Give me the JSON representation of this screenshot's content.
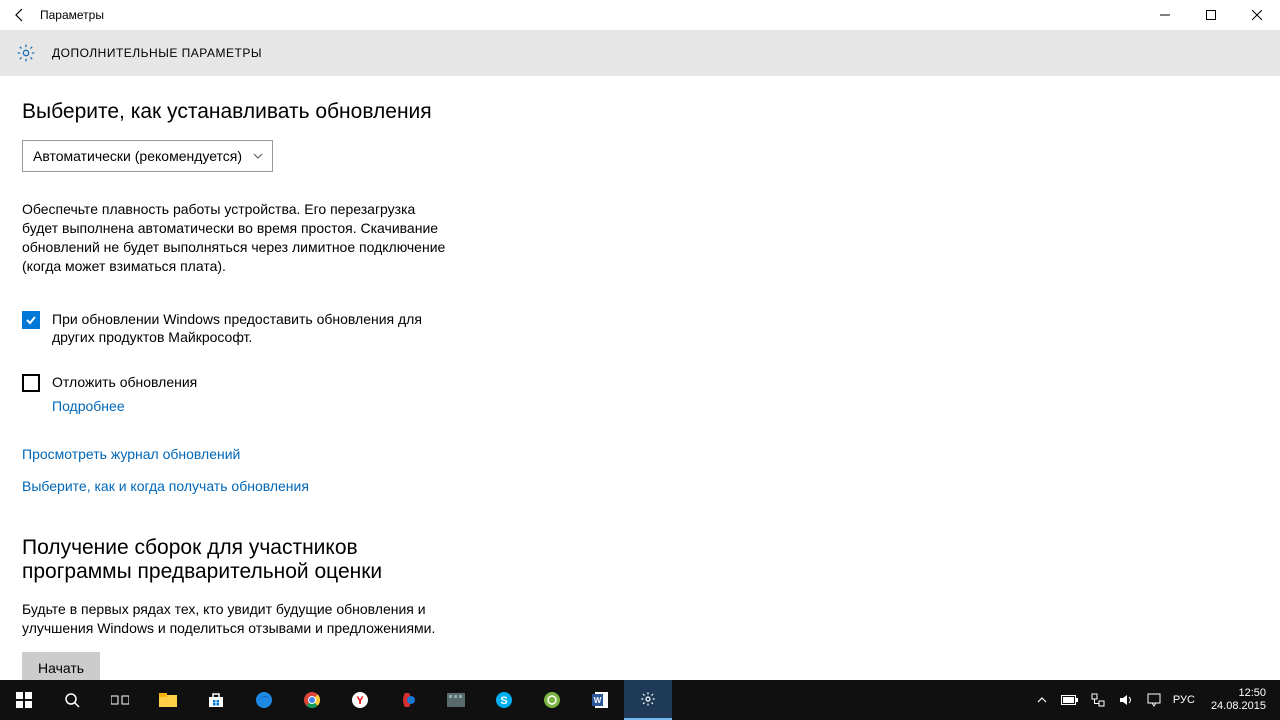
{
  "window": {
    "title": "Параметры"
  },
  "header": {
    "heading": "ДОПОЛНИТЕЛЬНЫЕ ПАРАМЕТРЫ"
  },
  "main": {
    "updates_title": "Выберите, как устанавливать обновления",
    "dropdown_value": "Автоматически (рекомендуется)",
    "paragraph": "Обеспечьте плавность работы устройства. Его перезагрузка будет выполнена автоматически во время простоя. Скачивание обновлений не будет выполняться через лимитное подключение (когда может взиматься плата).",
    "check1": {
      "checked": true,
      "label": "При обновлении Windows предоставить обновления для других продуктов Майкрософт."
    },
    "check2": {
      "checked": false,
      "label": "Отложить обновления",
      "more_link": "Подробнее"
    },
    "link_history": "Просмотреть журнал обновлений",
    "link_choose": "Выберите, как и когда получать обновления",
    "insider_title_l1": "Получение сборок для участников",
    "insider_title_l2": "программы предварительной оценки",
    "insider_desc": "Будьте в первых рядах тех, кто увидит будущие обновления и улучшения Windows и поделиться отзывами и предложениями.",
    "start_button": "Начать"
  },
  "taskbar": {
    "lang": "РУС",
    "clock_time": "12:50",
    "clock_date": "24.08.2015"
  }
}
